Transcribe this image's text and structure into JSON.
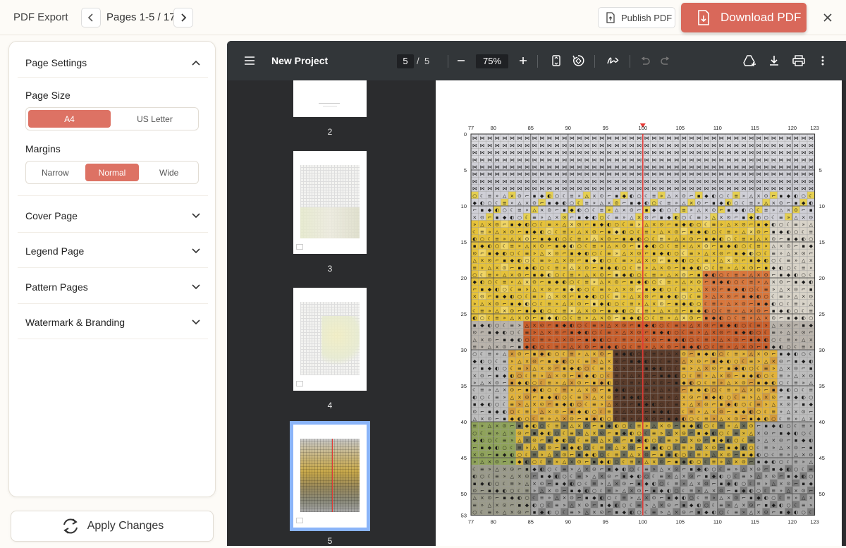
{
  "header": {
    "title": "PDF Export",
    "pages_label": "Pages 1-5 / 17",
    "publish_label": "Publish PDF",
    "download_label": "Download PDF"
  },
  "settings": {
    "page_settings_title": "Page Settings",
    "page_size_label": "Page Size",
    "page_size_options": [
      "A4",
      "US Letter"
    ],
    "page_size_selected": "A4",
    "margins_label": "Margins",
    "margins_options": [
      "Narrow",
      "Normal",
      "Wide"
    ],
    "margins_selected": "Normal",
    "sections": [
      "Cover Page",
      "Legend Page",
      "Pattern Pages",
      "Watermark & Branding"
    ],
    "apply_label": "Apply Changes"
  },
  "viewer": {
    "doc_title": "New Project",
    "current_page": "5",
    "page_sep": "/",
    "total_pages": "5",
    "zoom": "75%",
    "thumbnails": [
      "2",
      "3",
      "4",
      "5"
    ],
    "selected_thumbnail": "5"
  },
  "grid": {
    "top_labels": [
      "77",
      "80",
      "85",
      "90",
      "95",
      "100",
      "105",
      "110",
      "115",
      "120",
      "123"
    ],
    "left_labels": [
      "0",
      "5",
      "10",
      "15",
      "20",
      "25",
      "30",
      "35",
      "40",
      "45",
      "50",
      "53"
    ],
    "right_labels": [
      "5",
      "10",
      "15",
      "20",
      "25",
      "30",
      "35",
      "40",
      "45",
      "50"
    ],
    "bottom_labels": [
      "77",
      "80",
      "85",
      "90",
      "95",
      "100",
      "105",
      "110",
      "115",
      "120",
      "123"
    ],
    "highlight_column": "100"
  },
  "colors": {
    "accent": "#dd7264",
    "download": "#d9685a",
    "viewer_toolbar": "#323639",
    "viewer_bg": "#2b2c2e",
    "thumb_select": "#8ab4f8",
    "guide_line": "#e53935"
  }
}
